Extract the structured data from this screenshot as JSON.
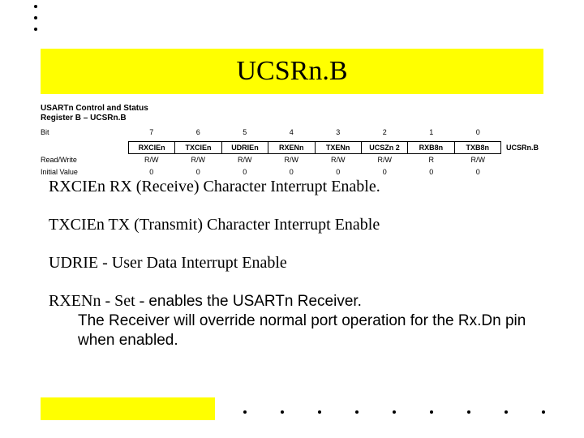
{
  "title": "UCSRn.B",
  "register": {
    "caption_line1": "USARTn Control and Status",
    "caption_line2": "Register B – UCSRn.B",
    "row_labels": {
      "bit": "Bit",
      "rw": "Read/Write",
      "init": "Initial Value"
    },
    "bit_numbers": [
      "7",
      "6",
      "5",
      "4",
      "3",
      "2",
      "1",
      "0"
    ],
    "bit_names": [
      "RXCIEn",
      "TXCIEn",
      "UDRIEn",
      "RXENn",
      "TXENn",
      "UCSZn 2",
      "RXB8n",
      "TXB8n"
    ],
    "side_label": "UCSRn.B",
    "rw": [
      "R/W",
      "R/W",
      "R/W",
      "R/W",
      "R/W",
      "R/W",
      "R",
      "R/W"
    ],
    "init": [
      "0",
      "0",
      "0",
      "0",
      "0",
      "0",
      "0",
      "0"
    ]
  },
  "body": {
    "p1": "RXCIEn RX (Receive) Character Interrupt Enable.",
    "p2": "TXCIEn TX (Transmit) Character Interrupt Enable",
    "p3": "UDRIE - User Data Interrupt Enable",
    "p4a": "RXENn - Set - ",
    "p4b": "enables the USARTn Receiver.",
    "p4c": "The Receiver will override normal port operation for the Rx.Dn pin when enabled."
  },
  "chart_data": {
    "type": "table",
    "title": "UCSRnB register bit layout",
    "columns": [
      "Bit",
      "Name",
      "Read/Write",
      "Initial Value"
    ],
    "rows": [
      {
        "Bit": 7,
        "Name": "RXCIEn",
        "Read/Write": "R/W",
        "Initial Value": 0
      },
      {
        "Bit": 6,
        "Name": "TXCIEn",
        "Read/Write": "R/W",
        "Initial Value": 0
      },
      {
        "Bit": 5,
        "Name": "UDRIEn",
        "Read/Write": "R/W",
        "Initial Value": 0
      },
      {
        "Bit": 4,
        "Name": "RXENn",
        "Read/Write": "R/W",
        "Initial Value": 0
      },
      {
        "Bit": 3,
        "Name": "TXENn",
        "Read/Write": "R/W",
        "Initial Value": 0
      },
      {
        "Bit": 2,
        "Name": "UCSZn2",
        "Read/Write": "R/W",
        "Initial Value": 0
      },
      {
        "Bit": 1,
        "Name": "RXB8n",
        "Read/Write": "R",
        "Initial Value": 0
      },
      {
        "Bit": 0,
        "Name": "TXB8n",
        "Read/Write": "R/W",
        "Initial Value": 0
      }
    ]
  }
}
